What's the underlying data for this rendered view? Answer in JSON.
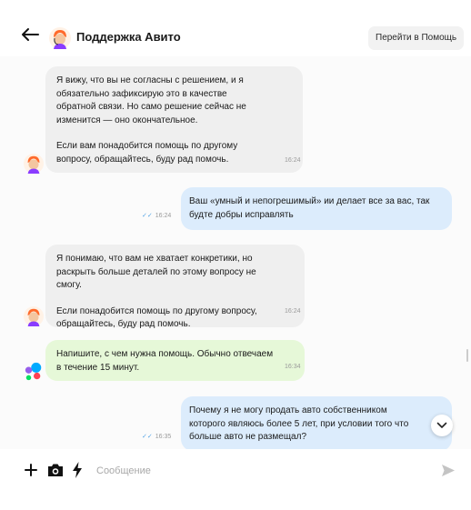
{
  "header": {
    "title": "Поддержка Авито",
    "help_button": "Перейти в Помощь"
  },
  "messages": [
    {
      "direction": "incoming",
      "paragraphs": [
        "Я вижу, что вы не согласны с решением, и я обязательно зафиксирую это в качестве обратной связи. Но само решение сейчас не изменится — оно окончательное.",
        "Если вам понадобится помощь по другому вопросу, обращайтесь, буду рад помочь."
      ],
      "time": "16:24"
    },
    {
      "direction": "outgoing",
      "text": "Ваш «умный и непогрешимый» ии делает все за вас, так будте добры исправлять",
      "time": "16:24",
      "read": true
    },
    {
      "direction": "incoming",
      "paragraphs": [
        "Я понимаю, что вам не хватает конкретики, но раскрыть больше деталей по этому вопросу не смогу.",
        "Если понадобится помощь по другому вопросу, обращайтесь, буду рад помочь."
      ],
      "time": "16:24"
    },
    {
      "direction": "bot",
      "text": "Напишите, с чем нужна помощь. Обычно отвечаем в течение 15 минут.",
      "time": "16:34"
    },
    {
      "direction": "outgoing",
      "text": "Почему я не могу продать авто собственником которого являюсь более 5 лет, при условии того что больше авто не размещал?",
      "time": "16:35",
      "read": true
    }
  ],
  "composer": {
    "placeholder": "Сообщение"
  },
  "icons": {
    "back": "arrow-left-icon",
    "plus": "plus-icon",
    "camera": "camera-icon",
    "bolt": "lightning-icon",
    "send": "send-icon",
    "scroll": "chevron-down-icon"
  },
  "colors": {
    "incoming_bubble": "#efefef",
    "outgoing_bubble": "#dcecfc",
    "bot_bubble": "#e6f8d8",
    "read_tick": "#57a6e6"
  }
}
